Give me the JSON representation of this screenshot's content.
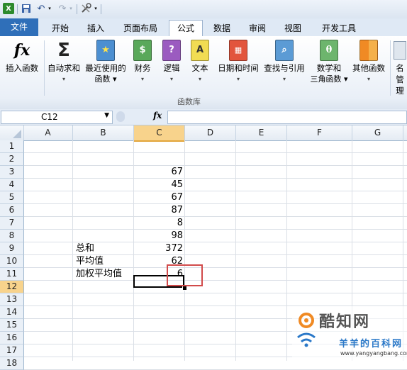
{
  "tabs": {
    "file": "文件",
    "items": [
      "开始",
      "插入",
      "页面布局",
      "公式",
      "数据",
      "审阅",
      "视图",
      "开发工具"
    ],
    "active": "公式"
  },
  "ribbon": {
    "buttons": [
      {
        "label1": "插入函数",
        "label2": "",
        "icon": "fx-icon"
      },
      {
        "label1": "自动求和",
        "label2": "▾",
        "icon": "sigma-icon"
      },
      {
        "label1": "最近使用的",
        "label2": "函数 ▾",
        "icon": "star-book-icon"
      },
      {
        "label1": "财务",
        "label2": "▾",
        "icon": "finance-book-icon"
      },
      {
        "label1": "逻辑",
        "label2": "▾",
        "icon": "logic-book-icon"
      },
      {
        "label1": "文本",
        "label2": "▾",
        "icon": "text-book-icon"
      },
      {
        "label1": "日期和时间",
        "label2": "▾",
        "icon": "date-book-icon"
      },
      {
        "label1": "查找与引用",
        "label2": "▾",
        "icon": "lookup-book-icon"
      },
      {
        "label1": "数学和",
        "label2": "三角函数 ▾",
        "icon": "math-book-icon"
      },
      {
        "label1": "其他函数",
        "label2": "▾",
        "icon": "more-books-icon"
      },
      {
        "label1": "名",
        "label2": "管理",
        "icon": "name-manager-icon"
      }
    ],
    "group_label": "函数库"
  },
  "formula_bar": {
    "name_box": "C12",
    "fx": "fx",
    "formula": ""
  },
  "columns": [
    "A",
    "B",
    "C",
    "D",
    "E",
    "F",
    "G"
  ],
  "selected_column": "C",
  "rows": [
    "1",
    "2",
    "3",
    "4",
    "5",
    "6",
    "7",
    "8",
    "9",
    "10",
    "11",
    "12",
    "13",
    "14",
    "15",
    "16",
    "17",
    "18"
  ],
  "selected_row": "12",
  "cells": {
    "c3": "67",
    "c4": "45",
    "c5": "67",
    "c6": "87",
    "c7": "8",
    "c8": "98",
    "b9": "总和",
    "c9": "372",
    "b10": "平均值",
    "c10": "62",
    "b11": "加权平均值",
    "c11": "6"
  },
  "watermark": {
    "brand": "酷知网",
    "sub": "羊羊的百科网",
    "url": "www.yangyangbang.com"
  },
  "colors": {
    "file_tab": "#2f6fb9",
    "selection_header": "#f8d38c",
    "highlight_box": "#d14a4a"
  }
}
